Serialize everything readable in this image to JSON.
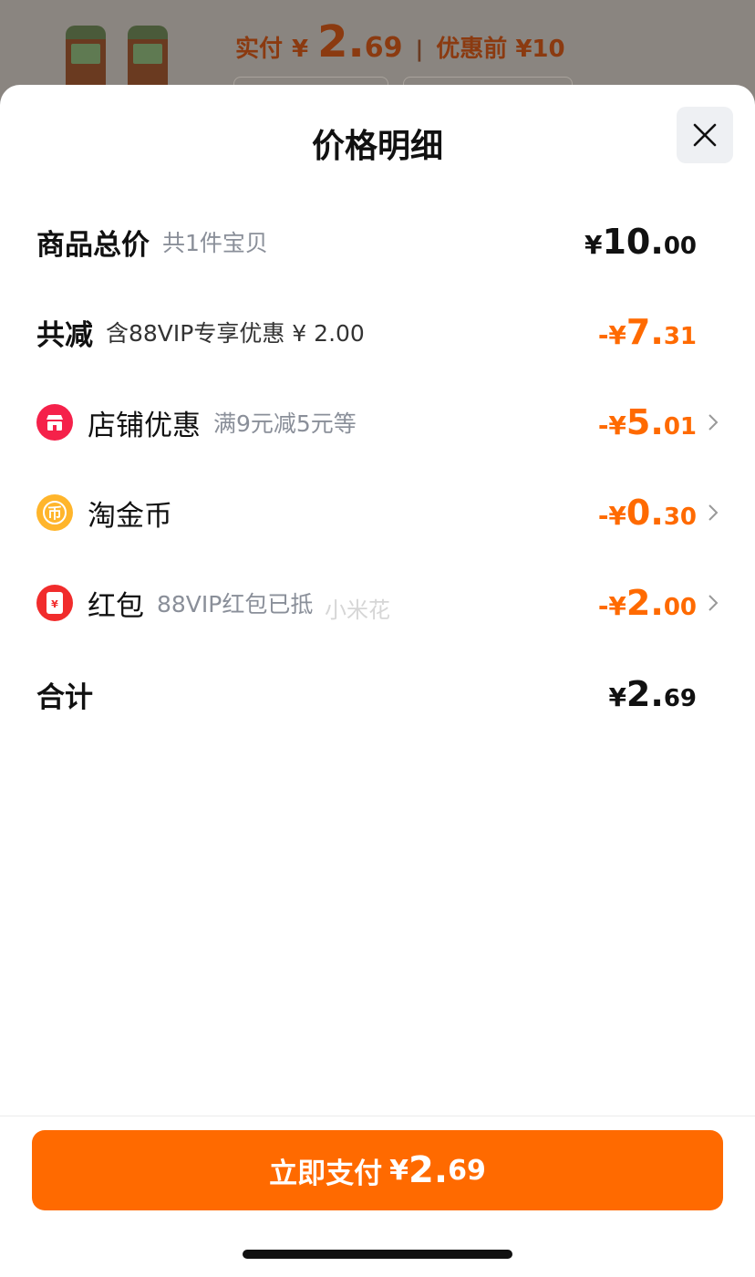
{
  "background": {
    "pay_label": "实付",
    "price_yen": "¥",
    "price_int": "2.",
    "price_dec": "69",
    "separator": "|",
    "original_price": "优惠前 ¥10"
  },
  "sheet": {
    "title": "价格明细",
    "close_icon": "close-icon"
  },
  "rows": {
    "total": {
      "label": "商品总价",
      "sub": "共1件宝贝",
      "sign": "¥",
      "int": "10.",
      "dec": "00"
    },
    "reduced": {
      "label": "共减",
      "sub": "含88VIP专享优惠 ¥ 2.00",
      "sign": "-¥",
      "int": "7.",
      "dec": "31"
    },
    "shop": {
      "label": "店铺优惠",
      "sub": "满9元减5元等",
      "sign": "-¥",
      "int": "5.",
      "dec": "01",
      "icon": "store-icon"
    },
    "coin": {
      "label": "淘金币",
      "sub": "",
      "sign": "-¥",
      "int": "0.",
      "dec": "30",
      "icon": "coin-icon",
      "icon_glyph": "币"
    },
    "redpack": {
      "label": "红包",
      "sub": "88VIP红包已抵",
      "sign": "-¥",
      "int": "2.",
      "dec": "00",
      "icon": "red-packet-icon",
      "icon_glyph": "¥"
    },
    "sum": {
      "label": "合计",
      "sign": "¥",
      "int": "2.",
      "dec": "69"
    }
  },
  "watermark": "小米花",
  "pay_button": {
    "label": "立即支付",
    "yen": "¥",
    "int": "2.",
    "dec": "69"
  },
  "colors": {
    "accent": "#ff6a00",
    "store_icon": "#f5214a",
    "coin_icon": "#ffb52b",
    "redpack_icon": "#f12c2c"
  }
}
